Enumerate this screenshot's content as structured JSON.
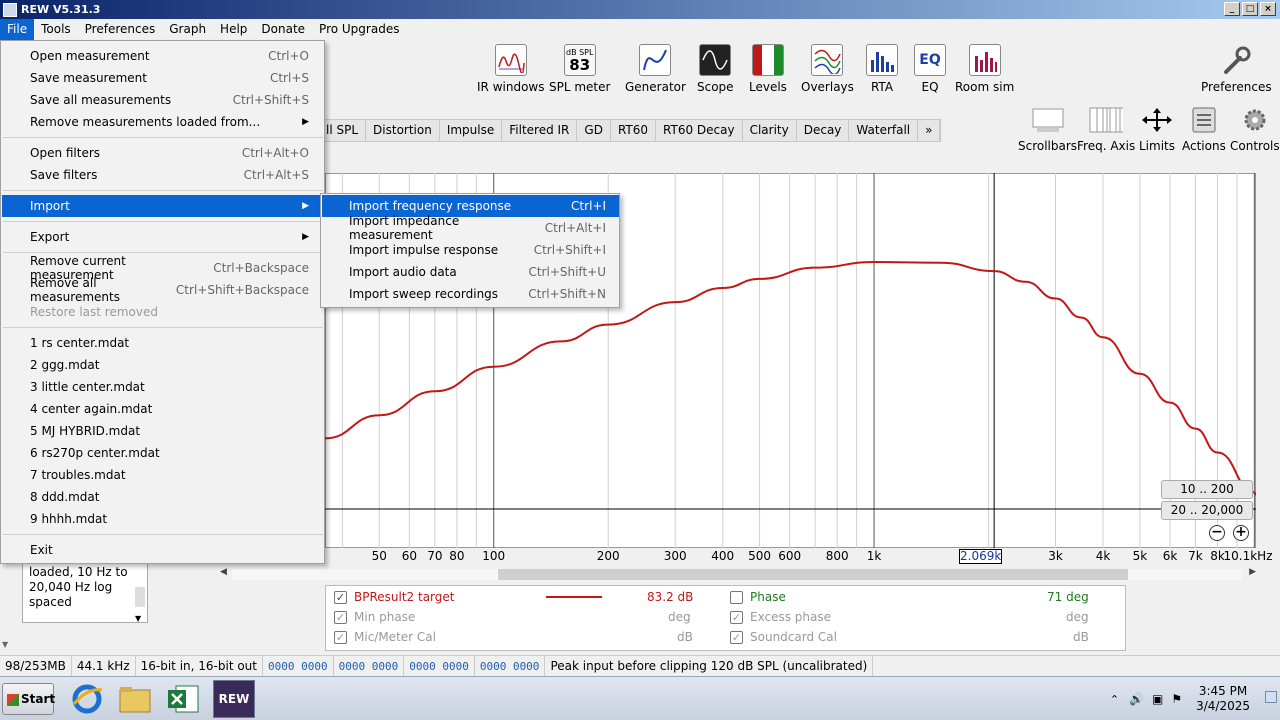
{
  "window": {
    "title": "REW V5.31.3"
  },
  "menubar": [
    "File",
    "Tools",
    "Preferences",
    "Graph",
    "Help",
    "Donate",
    "Pro Upgrades"
  ],
  "toolbar": [
    {
      "label": "IR windows",
      "icon": "ir-windows-icon"
    },
    {
      "label": "SPL meter",
      "icon": "spl-meter-icon",
      "badge_top": "dB SPL",
      "badge_value": "83"
    },
    {
      "label": "Generator",
      "icon": "generator-icon"
    },
    {
      "label": "Scope",
      "icon": "scope-icon"
    },
    {
      "label": "Levels",
      "icon": "levels-icon"
    },
    {
      "label": "Overlays",
      "icon": "overlays-icon"
    },
    {
      "label": "RTA",
      "icon": "rta-icon"
    },
    {
      "label": "EQ",
      "icon": "eq-icon"
    },
    {
      "label": "Room sim",
      "icon": "room-sim-icon"
    },
    {
      "label": "Preferences",
      "icon": "preferences-icon"
    }
  ],
  "graph_tabs": [
    "ll SPL",
    "Distortion",
    "Impulse",
    "Filtered IR",
    "GD",
    "RT60",
    "RT60 Decay",
    "Clarity",
    "Decay",
    "Waterfall",
    "»"
  ],
  "right_toolbar": [
    "Scrollbars",
    "Freq. Axis",
    "Limits",
    "Actions",
    "Controls"
  ],
  "file_menu": {
    "items": [
      {
        "label": "Open measurement",
        "shortcut": "Ctrl+O"
      },
      {
        "label": "Save measurement",
        "shortcut": "Ctrl+S"
      },
      {
        "label": "Save all measurements",
        "shortcut": "Ctrl+Shift+S"
      },
      {
        "label": "Remove measurements loaded from...",
        "shortcut": "▶"
      },
      {
        "label": "Open filters",
        "shortcut": "Ctrl+Alt+O"
      },
      {
        "label": "Save filters",
        "shortcut": "Ctrl+Alt+S"
      },
      {
        "label": "Import",
        "shortcut": "▶"
      },
      {
        "label": "Export",
        "shortcut": "▶"
      },
      {
        "label": "Remove current measurement",
        "shortcut": "Ctrl+Backspace"
      },
      {
        "label": "Remove all measurements",
        "shortcut": "Ctrl+Shift+Backspace"
      },
      {
        "label": "Restore last removed",
        "shortcut": ""
      },
      {
        "label": "1 rs center.mdat",
        "shortcut": ""
      },
      {
        "label": "2 ggg.mdat",
        "shortcut": ""
      },
      {
        "label": "3 little center.mdat",
        "shortcut": ""
      },
      {
        "label": "4 center again.mdat",
        "shortcut": ""
      },
      {
        "label": "5 MJ HYBRID.mdat",
        "shortcut": ""
      },
      {
        "label": "6 rs270p center.mdat",
        "shortcut": ""
      },
      {
        "label": "7 troubles.mdat",
        "shortcut": ""
      },
      {
        "label": "8 ddd.mdat",
        "shortcut": ""
      },
      {
        "label": "9 hhhh.mdat",
        "shortcut": ""
      },
      {
        "label": "Exit",
        "shortcut": ""
      }
    ]
  },
  "import_submenu": {
    "items": [
      {
        "label": "Import frequency response",
        "shortcut": "Ctrl+I"
      },
      {
        "label": "Import impedance measurement",
        "shortcut": "Ctrl+Alt+I"
      },
      {
        "label": "Import impulse response",
        "shortcut": "Ctrl+Shift+I"
      },
      {
        "label": "Import audio data",
        "shortcut": "Ctrl+Shift+U"
      },
      {
        "label": "Import sweep recordings",
        "shortcut": "Ctrl+Shift+N"
      }
    ]
  },
  "graph": {
    "x_ticks": [
      "50",
      "60",
      "70",
      "80",
      "100",
      "200",
      "300",
      "400",
      "500",
      "600",
      "800",
      "1k",
      "3k",
      "4k",
      "5k",
      "6k",
      "7k",
      "8k",
      "10.1kHz"
    ],
    "cursor_freq": "2.069k",
    "range_buttons": [
      "10 .. 200",
      "20 .. 20,000"
    ],
    "curve_color": "#c01818"
  },
  "chart_data": {
    "type": "line",
    "x_scale": "log",
    "series": [
      {
        "name": "BPResult2 target",
        "x": [
          36,
          50,
          70,
          100,
          150,
          200,
          300,
          400,
          500,
          700,
          1000,
          1500,
          2069,
          2500,
          3000,
          3500,
          4000,
          5000,
          6000,
          7000,
          8000,
          10000,
          10100
        ],
        "y": [
          -14.0,
          -10.7,
          -7.3,
          -3.8,
          -0.2,
          2.2,
          5.4,
          7.4,
          8.7,
          10.3,
          11.1,
          11.0,
          9.8,
          8.3,
          5.9,
          3.2,
          0.4,
          -4.8,
          -8.9,
          -12.6,
          -16.0,
          -21.7,
          -22.0
        ]
      }
    ]
  },
  "legend": {
    "rows": [
      {
        "label": "BPResult2 target",
        "value": "83.2 dB",
        "checked": true,
        "color": "#c01818"
      },
      {
        "label": "Phase",
        "value": "71 deg",
        "checked": false,
        "color": "#1f7a1f"
      },
      {
        "label": "Min phase",
        "value": "deg",
        "checked": true,
        "color": "#999999"
      },
      {
        "label": "Excess phase",
        "value": "deg",
        "checked": true,
        "color": "#999999"
      },
      {
        "label": "Mic/Meter Cal",
        "value": "dB",
        "checked": true,
        "color": "#999999"
      },
      {
        "label": "Soundcard Cal",
        "value": "dB",
        "checked": true,
        "color": "#999999"
      }
    ]
  },
  "info_box": {
    "text": "loaded, 10 Hz to 20,040 Hz log spaced"
  },
  "statusbar": {
    "memory": "98/253MB",
    "rate": "44.1 kHz",
    "bits": "16-bit in, 16-bit out",
    "codes": [
      "0000 0000",
      "0000 0000",
      "0000 0000",
      "0000 0000"
    ],
    "message": "Peak input before clipping 120 dB SPL (uncalibrated)"
  },
  "taskbar": {
    "start": "Start",
    "apps": [
      "internet-explorer-icon",
      "file-explorer-icon",
      "excel-icon",
      "rew-icon"
    ],
    "rew_label": "REW",
    "time": "3:45 PM",
    "date": "3/4/2025"
  }
}
